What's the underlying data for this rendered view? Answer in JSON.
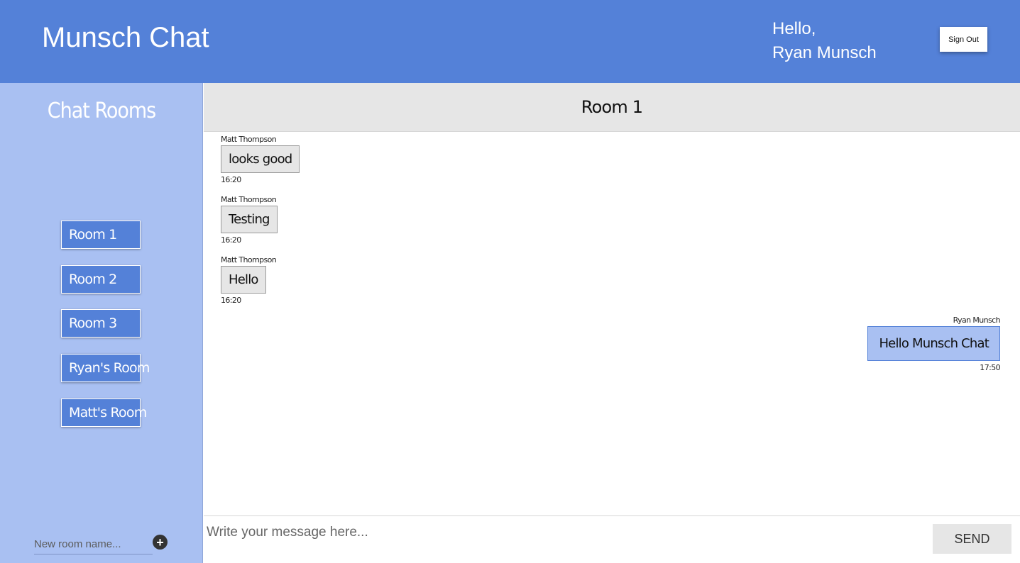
{
  "header": {
    "app_title": "Munsch Chat",
    "greeting_line1": "Hello,",
    "greeting_line2": "Ryan Munsch",
    "signout_label": "Sign Out"
  },
  "sidebar": {
    "title": "Chat Rooms",
    "rooms": [
      {
        "label": "Room 1"
      },
      {
        "label": "Room 2"
      },
      {
        "label": "Room 3"
      },
      {
        "label": "Ryan's Room"
      },
      {
        "label": "Matt's Room"
      }
    ],
    "new_room_placeholder": "New room name...",
    "add_icon": "plus-circle-icon"
  },
  "room": {
    "title": "Room 1"
  },
  "messages": [
    {
      "sender": "Matt Thompson",
      "text": "looks good",
      "time": "16:20",
      "own": false
    },
    {
      "sender": "Matt Thompson",
      "text": "Testing",
      "time": "16:20",
      "own": false
    },
    {
      "sender": "Matt Thompson",
      "text": "Hello",
      "time": "16:20",
      "own": false
    },
    {
      "sender": "Ryan Munsch",
      "text": "Hello Munsch Chat",
      "time": "17:50",
      "own": true
    }
  ],
  "composer": {
    "placeholder": "Write your message here...",
    "send_label": "SEND"
  },
  "colors": {
    "primary": "#5481d8",
    "sidebar": "#a9c0f2",
    "room_header": "#e6e6e6"
  }
}
